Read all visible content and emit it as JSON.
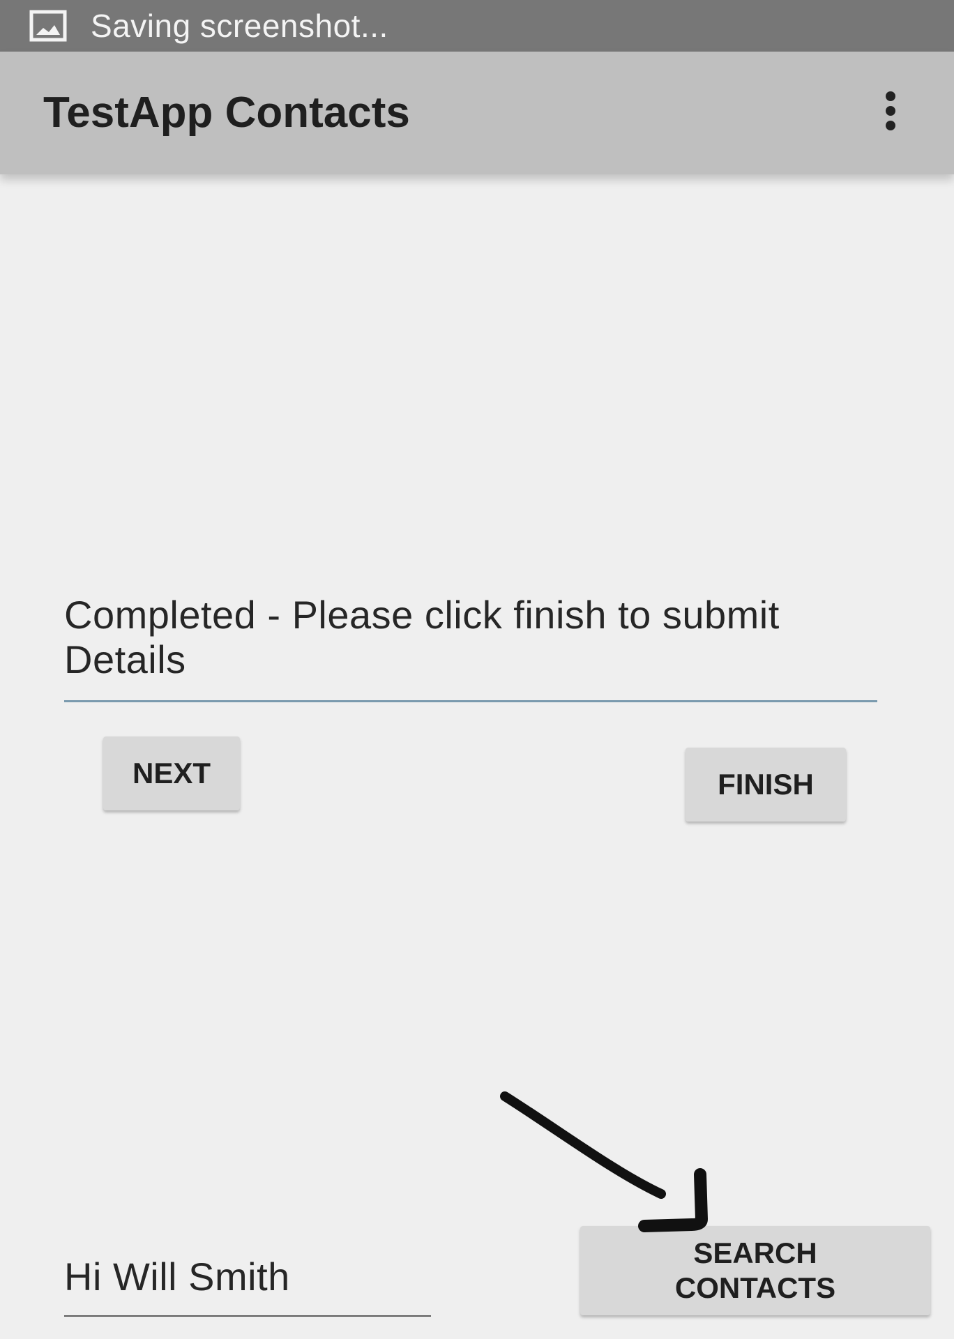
{
  "status_bar": {
    "icon": "screenshot-icon",
    "text": "Saving screenshot..."
  },
  "app_bar": {
    "title": "TestApp Contacts",
    "menu_icon": "overflow-menu-icon"
  },
  "main": {
    "message": "Completed - Please click finish to submit Details",
    "next_label": "NEXT",
    "finish_label": "FINISH",
    "greeting": "Hi Will Smith",
    "search_label_line1": "SEARCH",
    "search_label_line2": "CONTACTS"
  },
  "annotation": {
    "type": "hand-drawn-arrow",
    "target": "search-contacts-button",
    "color": "#111111"
  },
  "colors": {
    "status_bar": "#777777",
    "app_bar": "#bfbfbf",
    "background": "#efefef",
    "button": "#d8d8d8",
    "field_underline": "#7a9aae"
  }
}
